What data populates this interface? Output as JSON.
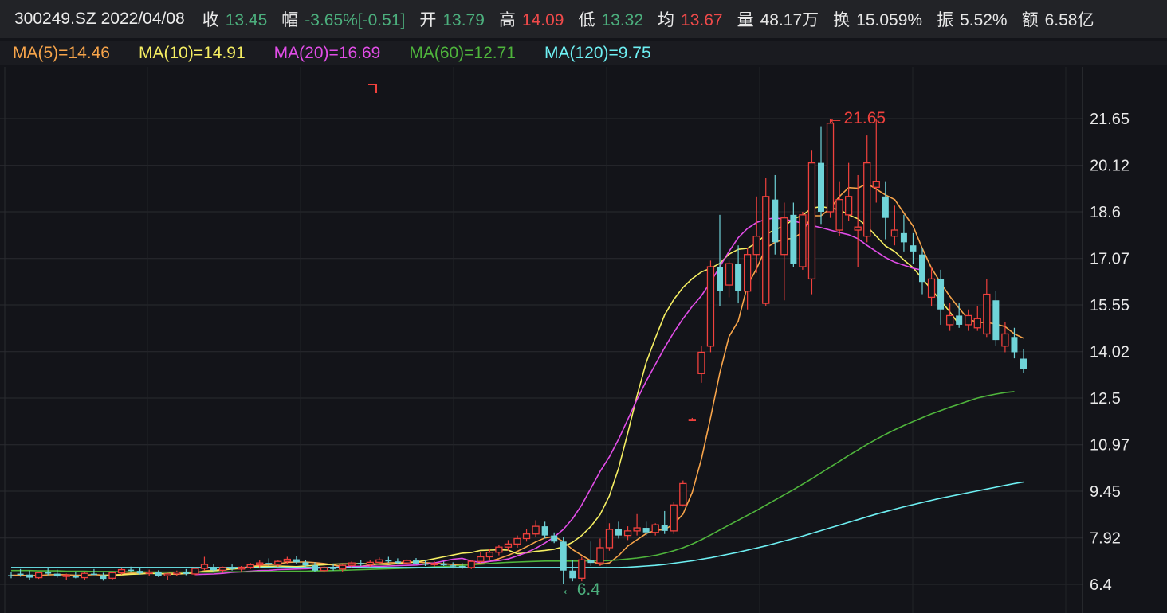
{
  "header": {
    "ticker": "300249.SZ",
    "date": "2022/04/08",
    "fields": [
      {
        "label": "收",
        "value": "13.45",
        "color": "#4caf7d"
      },
      {
        "label": "幅",
        "value": "-3.65%[-0.51]",
        "color": "#4caf7d"
      },
      {
        "label": "开",
        "value": "13.79",
        "color": "#4caf7d"
      },
      {
        "label": "高",
        "value": "14.09",
        "color": "#f04a4a"
      },
      {
        "label": "低",
        "value": "13.32",
        "color": "#4caf7d"
      },
      {
        "label": "均",
        "value": "13.67",
        "color": "#f04a4a"
      },
      {
        "label": "量",
        "value": "48.17万",
        "color": "#e6e6e6"
      },
      {
        "label": "换",
        "value": "15.059%",
        "color": "#e6e6e6"
      },
      {
        "label": "振",
        "value": "5.52%",
        "color": "#e6e6e6"
      },
      {
        "label": "额",
        "value": "6.58亿",
        "color": "#e6e6e6"
      }
    ]
  },
  "ma_legend": [
    {
      "text": "MA(5)=14.46",
      "color": "#f7a44a"
    },
    {
      "text": "MA(10)=14.91",
      "color": "#f5ee62"
    },
    {
      "text": "MA(20)=16.69",
      "color": "#e24de8"
    },
    {
      "text": "MA(60)=12.71",
      "color": "#4fb53c"
    },
    {
      "text": "MA(120)=9.75",
      "color": "#6ef0f3"
    }
  ],
  "chart_data": {
    "type": "candlestick",
    "y_ticks": [
      "21.65",
      "20.12",
      "18.6",
      "17.07",
      "15.55",
      "14.02",
      "12.5",
      "10.97",
      "9.45",
      "7.92",
      "6.4"
    ],
    "ylim": [
      6.4,
      21.65
    ],
    "annotations": {
      "high_label": "←21.65",
      "low_label": "←6.4"
    },
    "up_color": "#f0413d",
    "down_color": "#6fd3d8",
    "candles": [
      [
        6.7,
        6.8,
        6.6,
        6.68
      ],
      [
        6.75,
        6.9,
        6.65,
        6.72
      ],
      [
        6.72,
        6.85,
        6.55,
        6.62
      ],
      [
        6.62,
        6.8,
        6.58,
        6.78
      ],
      [
        6.8,
        6.95,
        6.7,
        6.75
      ],
      [
        6.75,
        6.88,
        6.62,
        6.66
      ],
      [
        6.66,
        6.75,
        6.55,
        6.7
      ],
      [
        6.68,
        6.82,
        6.6,
        6.62
      ],
      [
        6.62,
        6.8,
        6.55,
        6.76
      ],
      [
        6.75,
        6.9,
        6.7,
        6.72
      ],
      [
        6.7,
        6.78,
        6.52,
        6.58
      ],
      [
        6.6,
        6.82,
        6.55,
        6.78
      ],
      [
        6.78,
        6.95,
        6.72,
        6.88
      ],
      [
        6.88,
        6.98,
        6.8,
        6.84
      ],
      [
        6.84,
        6.95,
        6.72,
        6.76
      ],
      [
        6.76,
        6.88,
        6.68,
        6.8
      ],
      [
        6.8,
        6.86,
        6.64,
        6.68
      ],
      [
        6.68,
        6.78,
        6.55,
        6.74
      ],
      [
        6.74,
        6.85,
        6.68,
        6.8
      ],
      [
        6.8,
        6.9,
        6.7,
        6.74
      ],
      [
        6.74,
        6.95,
        6.7,
        6.92
      ],
      [
        6.92,
        7.3,
        6.85,
        7.05
      ],
      [
        6.95,
        7.05,
        6.8,
        6.86
      ],
      [
        6.86,
        6.98,
        6.78,
        6.95
      ],
      [
        6.95,
        7.05,
        6.85,
        6.9
      ],
      [
        6.9,
        7.0,
        6.82,
        6.96
      ],
      [
        6.96,
        7.1,
        6.9,
        7.04
      ],
      [
        7.04,
        7.2,
        6.95,
        7.1
      ],
      [
        7.1,
        7.25,
        7.0,
        7.05
      ],
      [
        7.05,
        7.18,
        6.98,
        7.15
      ],
      [
        7.15,
        7.3,
        7.05,
        7.22
      ],
      [
        7.22,
        7.32,
        7.08,
        7.12
      ],
      [
        7.12,
        7.2,
        6.95,
        7.02
      ],
      [
        7.02,
        7.12,
        6.8,
        6.85
      ],
      [
        6.85,
        7.0,
        6.78,
        6.95
      ],
      [
        6.95,
        7.08,
        6.85,
        6.9
      ],
      [
        6.9,
        7.05,
        6.82,
        7.02
      ],
      [
        7.02,
        7.15,
        6.95,
        7.1
      ],
      [
        7.1,
        7.2,
        7.0,
        7.05
      ],
      [
        7.05,
        7.18,
        6.98,
        7.12
      ],
      [
        7.12,
        7.28,
        7.05,
        7.2
      ],
      [
        7.2,
        7.3,
        7.1,
        7.15
      ],
      [
        7.15,
        7.25,
        7.05,
        7.1
      ],
      [
        7.1,
        7.22,
        7.0,
        7.18
      ],
      [
        7.18,
        7.26,
        7.05,
        7.08
      ],
      [
        7.08,
        7.18,
        7.0,
        7.05
      ],
      [
        7.05,
        7.15,
        6.98,
        7.08
      ],
      [
        7.08,
        7.15,
        7.0,
        7.02
      ],
      [
        7.02,
        7.12,
        6.92,
        7.0
      ],
      [
        7.0,
        7.1,
        6.9,
        6.95
      ],
      [
        6.95,
        7.2,
        6.9,
        7.15
      ],
      [
        7.15,
        7.45,
        7.1,
        7.3
      ],
      [
        7.3,
        7.55,
        7.2,
        7.45
      ],
      [
        7.45,
        7.7,
        7.35,
        7.62
      ],
      [
        7.62,
        7.85,
        7.5,
        7.72
      ],
      [
        7.72,
        8.0,
        7.6,
        7.9
      ],
      [
        7.9,
        8.2,
        7.8,
        8.05
      ],
      [
        8.05,
        8.5,
        7.95,
        8.3
      ],
      [
        8.3,
        8.45,
        7.9,
        8.0
      ],
      [
        8.0,
        8.1,
        7.75,
        7.8
      ],
      [
        7.8,
        7.95,
        6.4,
        6.85
      ],
      [
        6.85,
        7.2,
        6.5,
        6.6
      ],
      [
        6.6,
        7.3,
        6.5,
        7.2
      ],
      [
        7.2,
        7.8,
        7.0,
        7.1
      ],
      [
        7.1,
        7.9,
        7.0,
        7.6
      ],
      [
        7.6,
        8.4,
        7.5,
        8.2
      ],
      [
        8.2,
        8.45,
        7.9,
        8.0
      ],
      [
        8.0,
        8.3,
        7.85,
        8.15
      ],
      [
        8.15,
        8.7,
        8.0,
        8.25
      ],
      [
        8.25,
        8.45,
        8.0,
        8.1
      ],
      [
        8.1,
        8.4,
        8.0,
        8.35
      ],
      [
        8.35,
        8.8,
        8.05,
        8.15
      ],
      [
        8.15,
        9.1,
        8.05,
        9.0
      ],
      [
        9.0,
        9.8,
        8.95,
        9.7
      ],
      [
        11.8,
        11.85,
        11.75,
        11.8
      ],
      [
        13.3,
        14.2,
        13.0,
        14.0
      ],
      [
        14.2,
        17.0,
        14.0,
        16.8
      ],
      [
        16.8,
        18.5,
        15.5,
        16.0
      ],
      [
        16.2,
        17.0,
        15.8,
        16.9
      ],
      [
        16.9,
        17.5,
        15.6,
        16.0
      ],
      [
        16.0,
        17.4,
        15.4,
        17.2
      ],
      [
        17.2,
        19.1,
        16.6,
        17.8
      ],
      [
        15.6,
        19.7,
        15.5,
        19.1
      ],
      [
        19.0,
        19.8,
        17.2,
        17.6
      ],
      [
        17.2,
        18.9,
        15.7,
        18.4
      ],
      [
        18.5,
        18.9,
        16.8,
        16.9
      ],
      [
        16.8,
        18.6,
        16.7,
        18.5
      ],
      [
        16.4,
        20.6,
        15.9,
        20.2
      ],
      [
        20.2,
        21.4,
        18.2,
        18.6
      ],
      [
        18.6,
        21.65,
        18.4,
        21.5
      ],
      [
        18.0,
        19.6,
        17.8,
        19.0
      ],
      [
        18.5,
        20.2,
        18.3,
        19.1
      ],
      [
        18.0,
        19.8,
        16.8,
        18.1
      ],
      [
        17.8,
        21.1,
        17.6,
        20.2
      ],
      [
        19.4,
        21.65,
        18.9,
        19.6
      ],
      [
        19.1,
        19.6,
        17.7,
        18.4
      ],
      [
        17.8,
        18.8,
        17.5,
        18.0
      ],
      [
        17.9,
        18.5,
        17.3,
        17.6
      ],
      [
        17.5,
        17.9,
        16.9,
        17.3
      ],
      [
        17.2,
        17.4,
        15.9,
        16.3
      ],
      [
        15.8,
        16.8,
        15.5,
        16.4
      ],
      [
        16.4,
        16.7,
        14.9,
        15.4
      ],
      [
        14.9,
        15.6,
        14.7,
        15.2
      ],
      [
        15.2,
        15.6,
        14.8,
        14.9
      ],
      [
        14.9,
        15.4,
        14.7,
        15.2
      ],
      [
        14.8,
        15.5,
        14.7,
        15.1
      ],
      [
        14.6,
        16.4,
        14.5,
        15.9
      ],
      [
        15.7,
        16.0,
        14.2,
        14.4
      ],
      [
        14.2,
        15.0,
        14.0,
        14.6
      ],
      [
        14.5,
        14.8,
        13.8,
        14.0
      ],
      [
        13.79,
        14.09,
        13.32,
        13.45
      ]
    ],
    "ma": [
      {
        "name": "MA(5)",
        "color": "#f7a44a",
        "start": 0,
        "values": [
          6.7,
          6.7,
          6.69,
          6.69,
          6.71,
          6.72,
          6.71,
          6.7,
          6.7,
          6.72,
          6.7,
          6.7,
          6.73,
          6.77,
          6.78,
          6.8,
          6.8,
          6.79,
          6.76,
          6.75,
          6.78,
          6.84,
          6.86,
          6.89,
          6.92,
          6.94,
          6.98,
          7.02,
          7.04,
          7.07,
          7.12,
          7.13,
          7.13,
          7.11,
          7.08,
          7.03,
          6.98,
          6.98,
          6.99,
          7.03,
          7.07,
          7.1,
          7.11,
          7.13,
          7.13,
          7.11,
          7.09,
          7.07,
          7.05,
          7.03,
          7.05,
          7.09,
          7.15,
          7.24,
          7.35,
          7.48,
          7.63,
          7.79,
          7.92,
          7.97,
          7.8,
          7.54,
          7.35,
          7.17,
          7.05,
          7.1,
          7.34,
          7.65,
          7.86,
          8.06,
          8.17,
          8.19,
          8.38,
          8.7,
          9.41,
          10.5,
          11.87,
          13.32,
          14.51,
          15.02,
          16.18,
          16.74,
          17.41,
          17.6,
          17.7,
          17.73,
          17.94,
          18.47,
          18.47,
          18.71,
          19.1,
          19.39,
          19.37,
          19.52,
          19.34,
          19.15,
          19.0,
          18.56,
          18.13,
          17.4,
          16.76,
          16.27,
          15.83,
          15.44,
          15.08,
          14.98,
          14.98,
          14.92,
          14.84,
          14.6,
          14.46
        ]
      },
      {
        "name": "MA(10)",
        "color": "#f5ee62",
        "start": 10,
        "values": [
          6.7,
          6.7,
          6.71,
          6.73,
          6.74,
          6.76,
          6.75,
          6.74,
          6.73,
          6.76,
          6.78,
          6.82,
          6.84,
          6.87,
          6.9,
          6.92,
          6.96,
          6.98,
          6.99,
          7.0,
          6.99,
          6.98,
          7.0,
          7.02,
          7.04,
          7.06,
          7.07,
          7.07,
          7.08,
          7.07,
          7.06,
          7.05,
          7.08,
          7.1,
          7.13,
          7.18,
          7.24,
          7.3,
          7.36,
          7.42,
          7.44,
          7.51,
          7.52,
          7.53,
          7.52,
          7.4,
          7.43,
          7.48,
          7.51,
          7.55,
          7.63,
          7.78,
          8.0,
          8.3,
          8.69,
          9.3,
          10.2,
          11.35,
          12.57,
          13.66,
          14.47,
          15.22,
          15.73,
          16.12,
          16.41,
          16.63,
          16.75,
          16.91,
          17.21,
          17.37,
          17.4,
          17.59,
          17.85,
          18.02,
          18.13,
          18.36,
          18.49,
          18.72,
          18.77,
          18.72,
          18.67,
          18.5,
          18.37,
          18.12,
          17.8,
          17.48,
          17.3,
          17.02,
          16.77,
          16.41,
          16.05,
          15.69,
          15.32,
          14.91
        ]
      },
      {
        "name": "MA(20)",
        "color": "#e24de8",
        "start": 20,
        "values": [
          6.72,
          6.73,
          6.74,
          6.76,
          6.79,
          6.81,
          6.83,
          6.85,
          6.86,
          6.88,
          6.89,
          6.9,
          6.91,
          6.93,
          6.94,
          6.95,
          6.97,
          6.98,
          6.99,
          7.0,
          6.99,
          7.0,
          7.01,
          7.02,
          7.03,
          7.06,
          7.1,
          7.16,
          7.22,
          7.25,
          7.16,
          7.12,
          7.15,
          7.18,
          7.23,
          7.33,
          7.44,
          7.58,
          7.75,
          7.95,
          8.2,
          8.55,
          9.0,
          9.55,
          10.1,
          10.58,
          11.15,
          11.8,
          12.45,
          13.05,
          13.6,
          14.15,
          14.65,
          15.1,
          15.5,
          15.85,
          16.3,
          16.8,
          17.3,
          17.75,
          18.05,
          18.25,
          18.35,
          18.4,
          18.35,
          18.3,
          18.22,
          18.15,
          18.08,
          18.0,
          17.92,
          17.85,
          17.72,
          17.5,
          17.3,
          17.1,
          16.95,
          16.85,
          16.75,
          16.69
        ]
      },
      {
        "name": "MA(60)",
        "color": "#4fb53c",
        "start": 0,
        "values": [
          6.85,
          6.85,
          6.85,
          6.84,
          6.84,
          6.84,
          6.83,
          6.83,
          6.83,
          6.82,
          6.82,
          6.82,
          6.81,
          6.81,
          6.81,
          6.8,
          6.8,
          6.8,
          6.8,
          6.8,
          6.8,
          6.8,
          6.8,
          6.81,
          6.81,
          6.81,
          6.81,
          6.82,
          6.82,
          6.82,
          6.83,
          6.83,
          6.83,
          6.84,
          6.84,
          6.85,
          6.86,
          6.87,
          6.88,
          6.89,
          6.9,
          6.91,
          6.92,
          6.93,
          6.94,
          6.95,
          6.97,
          6.98,
          7.0,
          7.02,
          7.04,
          7.06,
          7.08,
          7.1,
          7.12,
          7.13,
          7.14,
          7.15,
          7.16,
          7.16,
          7.16,
          7.16,
          7.16,
          7.17,
          7.17,
          7.18,
          7.2,
          7.23,
          7.26,
          7.3,
          7.35,
          7.42,
          7.5,
          7.6,
          7.72,
          7.86,
          8.02,
          8.18,
          8.34,
          8.5,
          8.66,
          8.82,
          8.99,
          9.16,
          9.33,
          9.5,
          9.68,
          9.86,
          10.05,
          10.24,
          10.43,
          10.62,
          10.8,
          10.98,
          11.15,
          11.31,
          11.46,
          11.6,
          11.73,
          11.86,
          11.98,
          12.09,
          12.2,
          12.3,
          12.4,
          12.5,
          12.57,
          12.63,
          12.68,
          12.71
        ]
      },
      {
        "name": "MA(120)",
        "color": "#6ef0f3",
        "start": 0,
        "values": [
          6.95,
          6.95,
          6.95,
          6.95,
          6.95,
          6.95,
          6.95,
          6.95,
          6.95,
          6.95,
          6.95,
          6.95,
          6.95,
          6.95,
          6.95,
          6.95,
          6.95,
          6.95,
          6.95,
          6.95,
          6.95,
          6.95,
          6.95,
          6.95,
          6.95,
          6.95,
          6.95,
          6.95,
          6.95,
          6.95,
          6.95,
          6.95,
          6.95,
          6.95,
          6.95,
          6.95,
          6.95,
          6.95,
          6.95,
          6.95,
          6.95,
          6.95,
          6.95,
          6.95,
          6.95,
          6.95,
          6.95,
          6.95,
          6.95,
          6.95,
          6.95,
          6.95,
          6.95,
          6.95,
          6.95,
          6.95,
          6.95,
          6.95,
          6.95,
          6.95,
          6.95,
          6.95,
          6.95,
          6.95,
          6.95,
          6.95,
          6.95,
          6.96,
          6.98,
          7.0,
          7.02,
          7.05,
          7.09,
          7.13,
          7.17,
          7.22,
          7.27,
          7.33,
          7.39,
          7.45,
          7.52,
          7.59,
          7.66,
          7.74,
          7.82,
          7.9,
          7.98,
          8.07,
          8.16,
          8.25,
          8.34,
          8.43,
          8.52,
          8.61,
          8.7,
          8.78,
          8.86,
          8.94,
          9.01,
          9.08,
          9.15,
          9.22,
          9.28,
          9.34,
          9.4,
          9.46,
          9.52,
          9.58,
          9.64,
          9.7,
          9.75
        ]
      }
    ]
  }
}
